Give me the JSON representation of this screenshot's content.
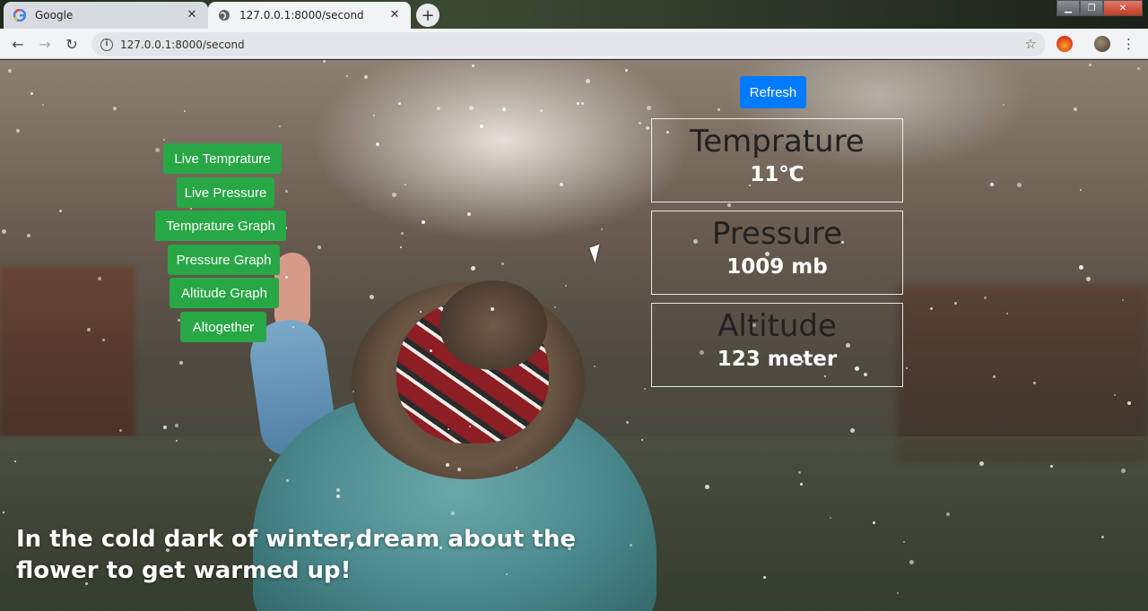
{
  "browser": {
    "tabs": [
      {
        "label": "Google",
        "active": false,
        "icon": "google-g-icon"
      },
      {
        "label": "127.0.0.1:8000/second",
        "active": true,
        "icon": "globe-icon"
      }
    ],
    "address": "127.0.0.1:8000/second"
  },
  "nav": {
    "buttons": [
      "Live Temprature",
      "Live Pressure",
      "Temprature Graph",
      "Pressure Graph",
      "Altitude Graph",
      "Altogether"
    ],
    "color": "#28a745"
  },
  "refresh_label": "Refresh",
  "readings": [
    {
      "label": "Temprature",
      "value": "11°C"
    },
    {
      "label": "Pressure",
      "value": "1009 mb"
    },
    {
      "label": "Altitude",
      "value": "123 meter"
    }
  ],
  "quote": {
    "line1": "In the cold dark of winter,dream about the",
    "line2": "flower to get warmed up!"
  }
}
